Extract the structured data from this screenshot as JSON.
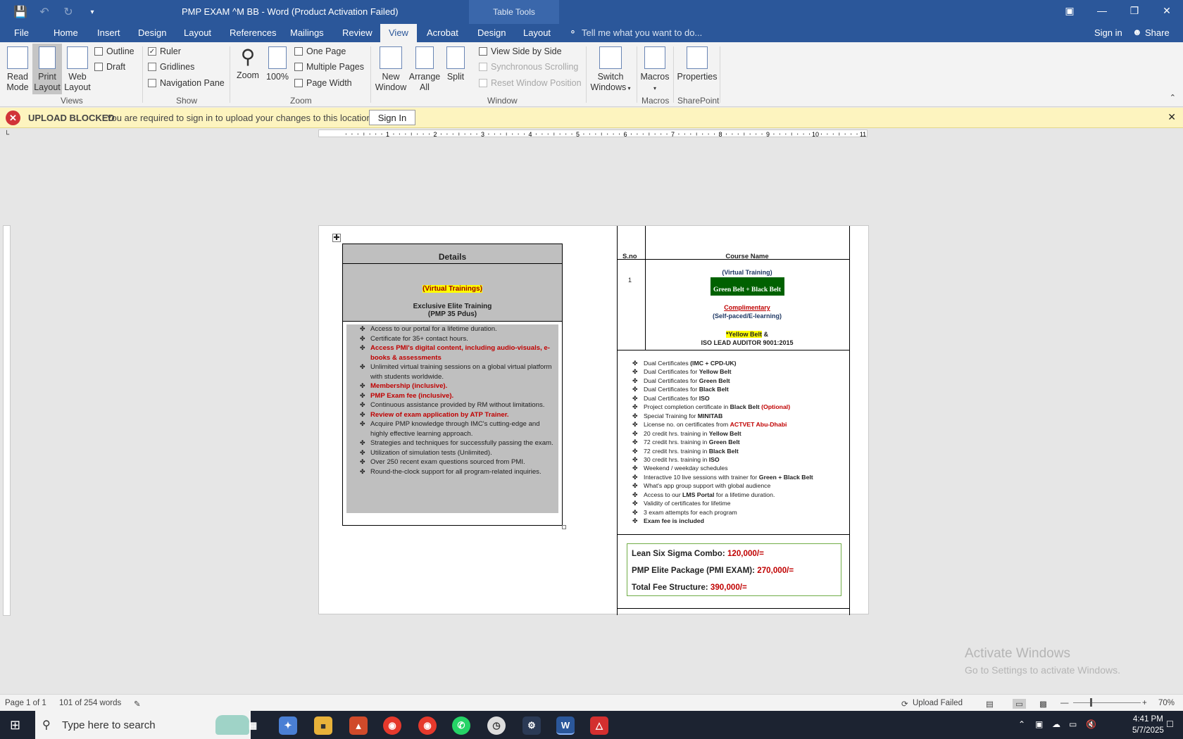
{
  "titlebar": {
    "title": "PMP EXAM ^M BB - Word (Product Activation Failed)",
    "table_tools": "Table Tools",
    "save_icon": "save-icon",
    "undo_icon": "undo-icon",
    "redo_icon": "redo-icon"
  },
  "tabs": {
    "file": "File",
    "home": "Home",
    "insert": "Insert",
    "design": "Design",
    "layout": "Layout",
    "references": "References",
    "mailings": "Mailings",
    "review": "Review",
    "view": "View",
    "acrobat": "Acrobat",
    "tt_design": "Design",
    "tt_layout": "Layout",
    "tell": "Tell me what you want to do...",
    "signin": "Sign in",
    "share": "Share"
  },
  "ribbon": {
    "read_mode": [
      "Read",
      "Mode"
    ],
    "print_layout": [
      "Print",
      "Layout"
    ],
    "web_layout": [
      "Web",
      "Layout"
    ],
    "outline": "Outline",
    "draft": "Draft",
    "views": "Views",
    "ruler": "Ruler",
    "gridlines": "Gridlines",
    "navpane": "Navigation Pane",
    "show": "Show",
    "zoom": "Zoom",
    "zoom100": "100%",
    "one_page": "One Page",
    "multi_pages": "Multiple Pages",
    "page_width": "Page Width",
    "zoom_group": "Zoom",
    "new_window": [
      "New",
      "Window"
    ],
    "arrange_all": [
      "Arrange",
      "All"
    ],
    "split": "Split",
    "side_by_side": "View Side by Side",
    "sync_scroll": "Synchronous Scrolling",
    "reset_pos": "Reset Window Position",
    "window_group": "Window",
    "switch_windows": [
      "Switch",
      "Windows"
    ],
    "macros": "Macros",
    "macros_group": "Macros",
    "properties": "Properties",
    "sharepoint": "SharePoint"
  },
  "msgbar": {
    "title": "UPLOAD BLOCKED",
    "text": "You are required to sign in to upload your changes to this location.",
    "button": "Sign In"
  },
  "ruler_numbers": [
    "1",
    "2",
    "3",
    "4",
    "5",
    "6",
    "7",
    "8",
    "9",
    "10",
    "11"
  ],
  "doc": {
    "left": {
      "header": "Details",
      "virtual": "(Virtual Trainings)",
      "elite": "Exclusive Elite Training",
      "pdus": "(PMP 35 Pdus)",
      "items": [
        {
          "text": "Access to our portal for a lifetime duration.",
          "style": ""
        },
        {
          "text": "Certificate for 35+ contact hours.",
          "style": ""
        },
        {
          "text": "Access PMI's digital content, including audio-visuals, e-books & assessments",
          "style": "red"
        },
        {
          "text": "Unlimited virtual training sessions on a global virtual platform with students worldwide.",
          "style": ""
        },
        {
          "text": "Membership (inclusive).",
          "style": "red"
        },
        {
          "text": "PMP Exam fee (inclusive).",
          "style": "red"
        },
        {
          "text": "Continuous assistance provided by RM without limitations.",
          "style": ""
        },
        {
          "text": " Review of exam application by ATP Trainer.",
          "style": "red"
        },
        {
          "text": "Acquire PMP knowledge through IMC's cutting-edge and highly effective learning approach.",
          "style": ""
        },
        {
          "text": "Strategies and techniques for successfully passing the exam.",
          "style": ""
        },
        {
          "text": "Utilization of simulation tests (Unlimited).",
          "style": ""
        },
        {
          "text": "Over 250 recent exam questions sourced from PMI.",
          "style": ""
        },
        {
          "text": "Round-the-clock support for all program-related inquiries.",
          "style": ""
        }
      ]
    },
    "right": {
      "sno_header": "S.no",
      "course_header": "Course Name",
      "sno": "1",
      "virtual": "(Virtual Training)",
      "green_black": "Green Belt + Black Belt",
      "complimentary": "Complimentary",
      "self_paced": "(Self-paced/E-learning)",
      "yellow": "*Yellow Belt",
      "amp": " &",
      "iso": "ISO LEAD AUDITOR 9001:2015",
      "items": [
        [
          "Dual Certificates ",
          "(IMC + CPD-UK)",
          ""
        ],
        [
          "Dual Certificates for ",
          "Yellow Belt",
          ""
        ],
        [
          "Dual Certificates for ",
          "Green Belt",
          ""
        ],
        [
          "Dual Certificates for ",
          "Black Belt",
          ""
        ],
        [
          "Dual Certificates for  ",
          "ISO",
          ""
        ],
        [
          " Project completion certificate in ",
          "Black Belt",
          " (Optional)"
        ],
        [
          "Special Training for ",
          "MINITAB",
          ""
        ],
        [
          "License no. on certificates from ",
          "ACTVET Abu-Dhabi",
          ""
        ],
        [
          "20 credit hrs. training in ",
          "Yellow Belt",
          ""
        ],
        [
          "72 credit hrs. training in ",
          "Green Belt",
          ""
        ],
        [
          "72 credit hrs. training in ",
          "Black Belt",
          ""
        ],
        [
          "30 credit hrs. training in  ",
          "ISO",
          ""
        ],
        [
          " Weekend / weekday schedules",
          "",
          ""
        ],
        [
          "Interactive 10 live sessions with trainer for ",
          "Green + Black Belt",
          ""
        ],
        [
          "What's app group support with global audience",
          "",
          ""
        ],
        [
          "Access to our ",
          "LMS Portal",
          " for a lifetime duration."
        ],
        [
          "Validity of certificates for lifetime",
          "",
          ""
        ],
        [
          "3 exam attempts for each program",
          "",
          ""
        ],
        [
          "",
          "Exam fee is included",
          ""
        ]
      ],
      "fees": [
        {
          "label": "Lean Six Sigma Combo: ",
          "value": "120,000/="
        },
        {
          "label": "PMP Elite Package (PMI EXAM): ",
          "value": "270,000/="
        },
        {
          "label": "Total Fee Structure: ",
          "value": "390,000/="
        }
      ]
    }
  },
  "watermark": {
    "line1": "Activate Windows",
    "line2": "Go to Settings to activate Windows."
  },
  "status": {
    "page": "Page 1 of 1",
    "words": "101 of 254 words",
    "upload": "Upload Failed",
    "zoom": "70%"
  },
  "taskbar": {
    "search": "Type here to search",
    "time": "4:41 PM",
    "date": "5/7/2025"
  },
  "colors": {
    "word_blue": "#2b579a",
    "msg_yellow": "#fdf4bf",
    "dark_red": "#c00000",
    "dark_green": "#006100"
  }
}
